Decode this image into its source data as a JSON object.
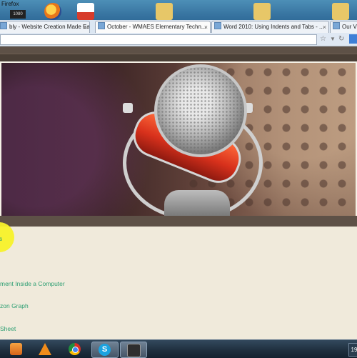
{
  "window": {
    "title": "Firefox",
    "badge": "1080"
  },
  "tabs": [
    {
      "label": "bly - Website Creation Made Easy",
      "active": false
    },
    {
      "label": "October - WMAES Elementary Techn...",
      "active": true
    },
    {
      "label": "Word 2010: Using Indents and Tabs - ...",
      "active": false
    },
    {
      "label": "Our Vide",
      "active": false
    }
  ],
  "tab_close_glyph": "×",
  "page": {
    "links": [
      "s",
      "ment Inside a Computer",
      "zon Graph",
      "Sheet"
    ]
  },
  "taskbar": {
    "skype_glyph": "S",
    "tray_text": "19"
  },
  "colors": {
    "link": "#2e9f73",
    "highlight": "#f7f22a",
    "banner_frame": "#5e5147"
  }
}
